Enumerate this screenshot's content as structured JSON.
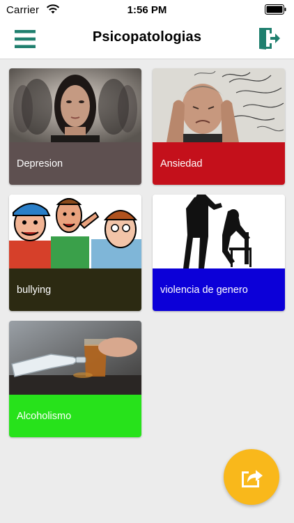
{
  "status_bar": {
    "carrier": "Carrier",
    "time": "1:56 PM",
    "icons": [
      "wifi-icon",
      "battery-icon"
    ]
  },
  "header": {
    "title": "Psicopatologias",
    "left_icon": "menu-icon",
    "right_icon": "exit-icon",
    "accent_color": "#1f7f6e"
  },
  "cards": [
    {
      "label": "Depresion",
      "color": "#5e5050",
      "image": "woman-portrait-image"
    },
    {
      "label": "Ansiedad",
      "color": "#c4101b",
      "image": "stressed-man-image"
    },
    {
      "label": "bullying",
      "color": "#2c2a12",
      "image": "cartoon-kids-image"
    },
    {
      "label": "violencia de genero",
      "color": "#0c00d8",
      "image": "silhouette-violence-image"
    },
    {
      "label": "Alcoholismo",
      "color": "#27e21b",
      "image": "bottle-glass-image"
    }
  ],
  "fab": {
    "icon": "share-icon",
    "color": "#f9b81b"
  }
}
